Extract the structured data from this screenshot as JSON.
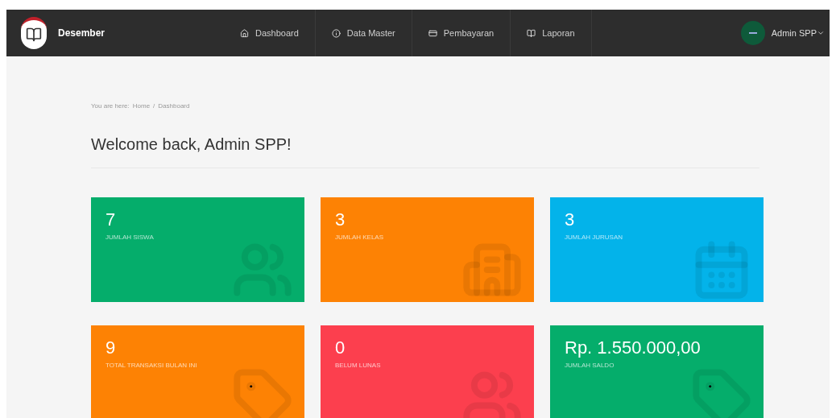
{
  "navbar": {
    "brand": "Desember",
    "menu": [
      {
        "kind": "home",
        "label": "Dashboard"
      },
      {
        "kind": "info",
        "label": "Data Master"
      },
      {
        "kind": "card",
        "label": "Pembayaran"
      },
      {
        "kind": "book",
        "label": "Laporan"
      }
    ],
    "user": "Admin SPP"
  },
  "breadcrumb": {
    "prefix": "You are here:",
    "items": [
      "Home",
      "Dashboard"
    ],
    "separator": "/"
  },
  "heading": "Welcome back, Admin SPP!",
  "cards": [
    {
      "value": "7",
      "label": "JUMLAH SISWA",
      "color": "#05ad6b",
      "kind": "users"
    },
    {
      "value": "3",
      "label": "JUMLAH KELAS",
      "color": "#fd8204",
      "kind": "building"
    },
    {
      "value": "3",
      "label": "JUMLAH JURUSAN",
      "color": "#03b3ea",
      "kind": "calendar"
    },
    {
      "value": "9",
      "label": "TOTAL TRANSAKSI BULAN INI",
      "color": "#fd8204",
      "kind": "tag"
    },
    {
      "value": "0",
      "label": "BELUM LUNAS",
      "color": "#fc3f4e",
      "kind": "users"
    },
    {
      "value": "Rp. 1.550.000,00",
      "label": "JUMLAH SALDO",
      "color": "#05ad6b",
      "kind": "tag"
    }
  ]
}
